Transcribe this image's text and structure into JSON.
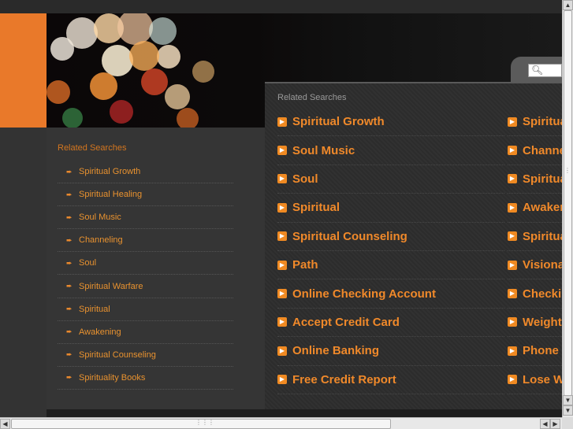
{
  "header": {
    "search": {
      "placeholder": ""
    }
  },
  "left_sidebar": {
    "title": "Related Searches",
    "items": [
      "Spiritual Growth",
      "Spiritual Healing",
      "Soul Music",
      "Channeling",
      "Soul",
      "Spiritual Warfare",
      "Spiritual",
      "Awakening",
      "Spiritual Counseling",
      "Spirituality Books"
    ]
  },
  "main": {
    "title": "Related Searches",
    "column1": [
      "Spiritual Growth",
      "Soul Music",
      "Soul",
      "Spiritual",
      "Spiritual Counseling",
      "Path",
      "Online Checking Account",
      "Accept Credit Card",
      "Online Banking",
      "Free Credit Report"
    ],
    "column2": [
      "Spiritua",
      "Channe",
      "Spiritua",
      "Awaken",
      "Spiritua",
      "Visiona",
      "Checki",
      "Weight",
      "Phone",
      "Lose W"
    ]
  },
  "colors": {
    "accent": "#e9792a",
    "link": "#f0892a",
    "background": "#2e2e2e"
  },
  "icons": {
    "list_arrow": "arrow-right-icon",
    "search": "magnifier-icon"
  }
}
